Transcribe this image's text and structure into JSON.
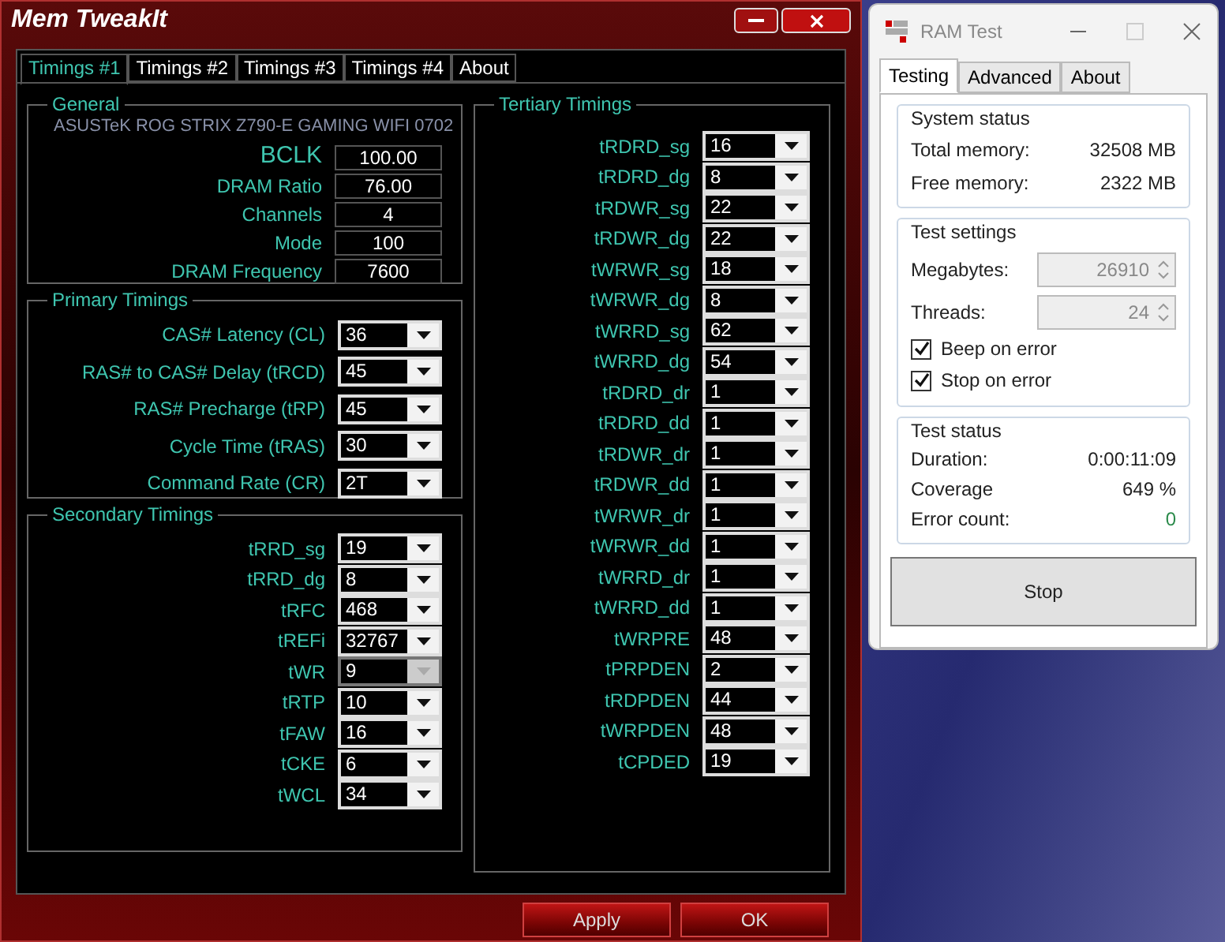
{
  "mem_tweakit": {
    "title": "Mem TweakIt",
    "tabs": [
      {
        "label": "Timings #1",
        "selected": true
      },
      {
        "label": "Timings #2",
        "selected": false
      },
      {
        "label": "Timings #3",
        "selected": false
      },
      {
        "label": "Timings #4",
        "selected": false
      },
      {
        "label": "About",
        "selected": false
      }
    ],
    "general": {
      "title": "General",
      "board": "ASUSTeK ROG STRIX Z790-E GAMING WIFI 0702",
      "fields": [
        {
          "label": "BCLK",
          "value": "100.00"
        },
        {
          "label": "DRAM Ratio",
          "value": "76.00"
        },
        {
          "label": "Channels",
          "value": "4"
        },
        {
          "label": "Mode",
          "value": "100"
        },
        {
          "label": "DRAM Frequency",
          "value": "7600"
        }
      ]
    },
    "primary": {
      "title": "Primary Timings",
      "rows": [
        {
          "label": "CAS# Latency (CL)",
          "value": "36",
          "disabled": false
        },
        {
          "label": "RAS# to CAS# Delay (tRCD)",
          "value": "45",
          "disabled": false
        },
        {
          "label": "RAS# Precharge (tRP)",
          "value": "45",
          "disabled": false
        },
        {
          "label": "Cycle Time (tRAS)",
          "value": "30",
          "disabled": false
        },
        {
          "label": "Command Rate (CR)",
          "value": "2T",
          "disabled": false
        }
      ]
    },
    "secondary": {
      "title": "Secondary Timings",
      "rows": [
        {
          "label": "tRRD_sg",
          "value": "19",
          "disabled": false
        },
        {
          "label": "tRRD_dg",
          "value": "8",
          "disabled": false
        },
        {
          "label": "tRFC",
          "value": "468",
          "disabled": false
        },
        {
          "label": "tREFi",
          "value": "32767",
          "disabled": false
        },
        {
          "label": "tWR",
          "value": "9",
          "disabled": true
        },
        {
          "label": "tRTP",
          "value": "10",
          "disabled": false
        },
        {
          "label": "tFAW",
          "value": "16",
          "disabled": false
        },
        {
          "label": "tCKE",
          "value": "6",
          "disabled": false
        },
        {
          "label": "tWCL",
          "value": "34",
          "disabled": false
        }
      ]
    },
    "tertiary": {
      "title": "Tertiary Timings",
      "rows": [
        {
          "label": "tRDRD_sg",
          "value": "16",
          "disabled": false
        },
        {
          "label": "tRDRD_dg",
          "value": "8",
          "disabled": false
        },
        {
          "label": "tRDWR_sg",
          "value": "22",
          "disabled": false
        },
        {
          "label": "tRDWR_dg",
          "value": "22",
          "disabled": false
        },
        {
          "label": "tWRWR_sg",
          "value": "18",
          "disabled": false
        },
        {
          "label": "tWRWR_dg",
          "value": "8",
          "disabled": false
        },
        {
          "label": "tWRRD_sg",
          "value": "62",
          "disabled": false
        },
        {
          "label": "tWRRD_dg",
          "value": "54",
          "disabled": false
        },
        {
          "label": "tRDRD_dr",
          "value": "1",
          "disabled": false
        },
        {
          "label": "tRDRD_dd",
          "value": "1",
          "disabled": false
        },
        {
          "label": "tRDWR_dr",
          "value": "1",
          "disabled": false
        },
        {
          "label": "tRDWR_dd",
          "value": "1",
          "disabled": false
        },
        {
          "label": "tWRWR_dr",
          "value": "1",
          "disabled": false
        },
        {
          "label": "tWRWR_dd",
          "value": "1",
          "disabled": false
        },
        {
          "label": "tWRRD_dr",
          "value": "1",
          "disabled": false
        },
        {
          "label": "tWRRD_dd",
          "value": "1",
          "disabled": false
        },
        {
          "label": "tWRPRE",
          "value": "48",
          "disabled": false
        },
        {
          "label": "tPRPDEN",
          "value": "2",
          "disabled": false
        },
        {
          "label": "tRDPDEN",
          "value": "44",
          "disabled": false
        },
        {
          "label": "tWRPDEN",
          "value": "48",
          "disabled": false
        },
        {
          "label": "tCPDED",
          "value": "19",
          "disabled": false
        }
      ]
    },
    "buttons": [
      "Apply",
      "OK"
    ]
  },
  "ram_test": {
    "title": "RAM Test",
    "tabs": [
      {
        "label": "Testing",
        "selected": true
      },
      {
        "label": "Advanced",
        "selected": false
      },
      {
        "label": "About",
        "selected": false
      }
    ],
    "system_status": {
      "title": "System status",
      "rows": [
        {
          "label": "Total memory:",
          "value": "32508 MB"
        },
        {
          "label": "Free memory:",
          "value": "2322 MB"
        }
      ]
    },
    "test_settings": {
      "title": "Test settings",
      "spinners": [
        {
          "label": "Megabytes:",
          "value": "26910",
          "disabled": true
        },
        {
          "label": "Threads:",
          "value": "24",
          "disabled": true
        }
      ],
      "checkboxes": [
        {
          "label": "Beep on error",
          "checked": true
        },
        {
          "label": "Stop on error",
          "checked": true
        }
      ]
    },
    "test_status": {
      "title": "Test status",
      "rows": [
        {
          "label": "Duration:",
          "value": "0:00:11:09"
        },
        {
          "label": "Coverage",
          "value": "649 %"
        },
        {
          "label": "Error count:",
          "value": "0"
        }
      ]
    },
    "button": "Stop"
  }
}
